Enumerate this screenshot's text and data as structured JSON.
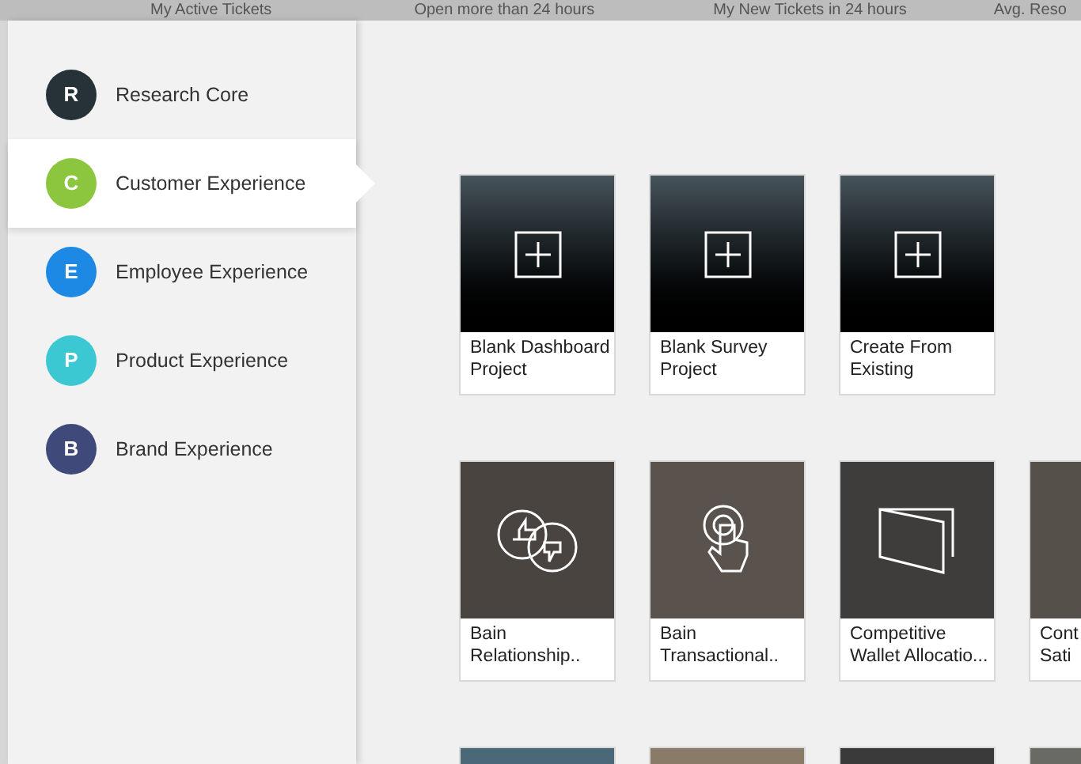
{
  "backdrop_header": [
    "My Active Tickets",
    "Open more than 24 hours",
    "My New Tickets in 24 hours",
    "Avg. Reso"
  ],
  "sidebar": {
    "items": [
      {
        "label": "Research Core",
        "letter": "R",
        "color": "#263238",
        "selected": false
      },
      {
        "label": "Customer Experience",
        "letter": "C",
        "color": "#8cc63f",
        "selected": true
      },
      {
        "label": "Employee Experience",
        "letter": "E",
        "color": "#1e88e5",
        "selected": false
      },
      {
        "label": "Product Experience",
        "letter": "P",
        "color": "#3cc8d2",
        "selected": false
      },
      {
        "label": "Brand Experience",
        "letter": "B",
        "color": "#3f4a7a",
        "selected": false
      }
    ]
  },
  "project_rows": [
    [
      {
        "kind": "blank",
        "lines": [
          "Blank Dashboard",
          "Project"
        ]
      },
      {
        "kind": "blank",
        "lines": [
          "Blank Survey",
          "Project"
        ]
      },
      {
        "kind": "blank",
        "lines": [
          "Create From",
          "Existing"
        ]
      }
    ],
    [
      {
        "kind": "template",
        "lines": [
          "Bain",
          "Relationship.."
        ]
      },
      {
        "kind": "template",
        "lines": [
          "Bain",
          "Transactional.."
        ]
      },
      {
        "kind": "template",
        "lines": [
          "Competitive",
          "Wallet Allocatio..."
        ]
      },
      {
        "kind": "template",
        "lines": [
          "Cont",
          "Sati"
        ]
      }
    ],
    [
      {
        "kind": "template"
      },
      {
        "kind": "template"
      },
      {
        "kind": "template"
      },
      {
        "kind": "template"
      }
    ]
  ]
}
